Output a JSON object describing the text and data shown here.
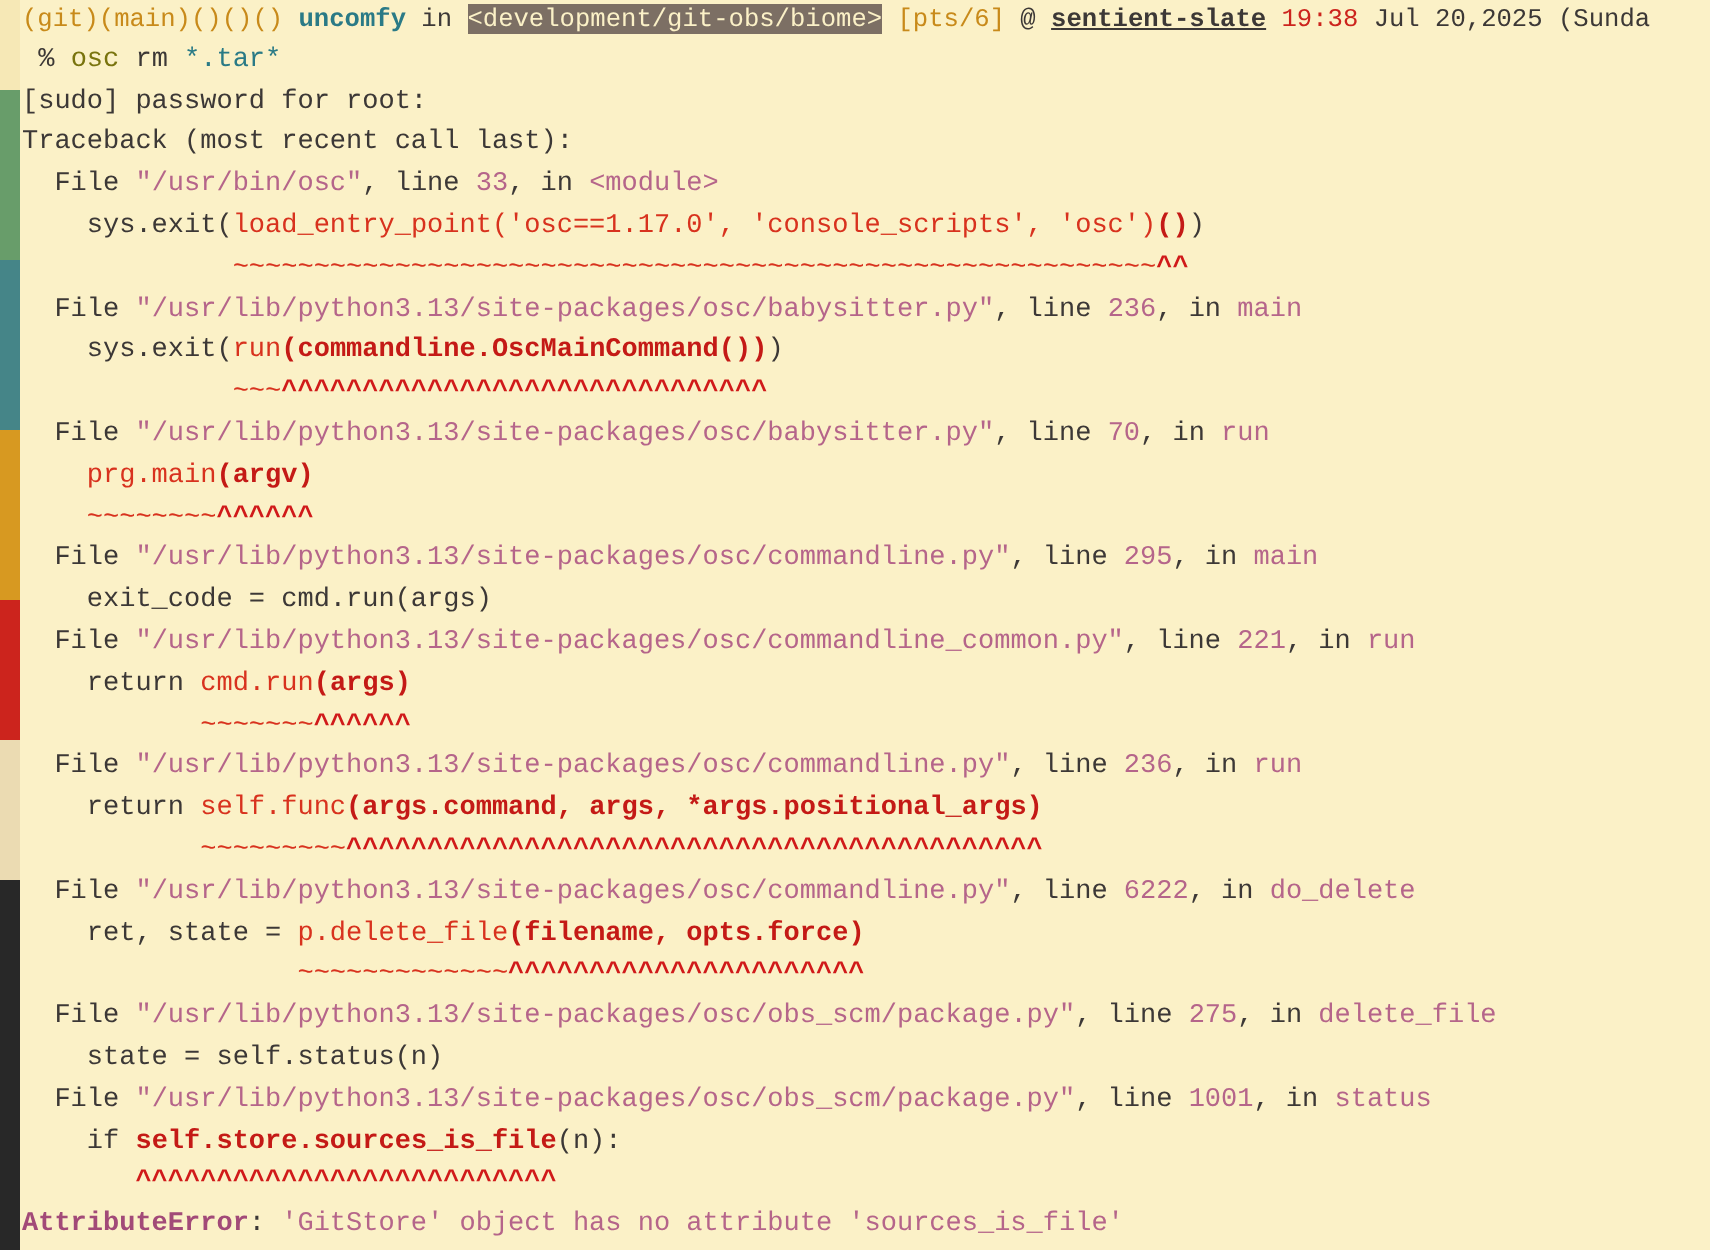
{
  "prompt": [
    {
      "kind": "git",
      "text": "(git)(main)()()()"
    },
    {
      "kind": "user",
      "text": " uncomfy"
    },
    {
      "kind": "plain",
      "text": " in "
    },
    {
      "kind": "dir",
      "text": "<development/git-obs/biome>"
    },
    {
      "kind": "git",
      "text": " [pts/6]"
    },
    {
      "kind": "plain",
      "text": " @ "
    },
    {
      "kind": "host",
      "text": "sentient-slate"
    },
    {
      "kind": "time",
      "text": " 19:38"
    },
    {
      "kind": "plain",
      "text": " Jul 20,2025 (Sunda"
    }
  ],
  "command": [
    {
      "kind": "plain",
      "text": " % "
    },
    {
      "kind": "cmd",
      "text": "osc"
    },
    {
      "kind": "plain",
      "text": " rm "
    },
    {
      "kind": "arg",
      "text": "*.tar*"
    }
  ],
  "lines": [
    [
      {
        "kind": "plain",
        "text": "[sudo] password for root:"
      }
    ],
    [
      {
        "kind": "plain",
        "text": "Traceback (most recent call last):"
      }
    ],
    [
      {
        "kind": "plain",
        "text": "  File "
      },
      {
        "kind": "pink",
        "text": "\"/usr/bin/osc\""
      },
      {
        "kind": "plain",
        "text": ", line "
      },
      {
        "kind": "pink",
        "text": "33"
      },
      {
        "kind": "plain",
        "text": ", in "
      },
      {
        "kind": "pink",
        "text": "<module>"
      }
    ],
    [
      {
        "kind": "plain",
        "text": "    sys.exit("
      },
      {
        "kind": "call",
        "text": "load_entry_point('osc==1.17.0', 'console_scripts', 'osc')"
      },
      {
        "kind": "bold",
        "text": "()"
      },
      {
        "kind": "plain",
        "text": ")"
      }
    ],
    [
      {
        "kind": "tilde",
        "text": "             ~~~~~~~~~~~~~~~~~~~~~~~~~~~~~~~~~~~~~~~~~~~~~~~~~~~~~~~~~"
      },
      {
        "kind": "caret",
        "text": "^^"
      }
    ],
    [
      {
        "kind": "plain",
        "text": "  File "
      },
      {
        "kind": "pink",
        "text": "\"/usr/lib/python3.13/site-packages/osc/babysitter.py\""
      },
      {
        "kind": "plain",
        "text": ", line "
      },
      {
        "kind": "pink",
        "text": "236"
      },
      {
        "kind": "plain",
        "text": ", in "
      },
      {
        "kind": "pink",
        "text": "main"
      }
    ],
    [
      {
        "kind": "plain",
        "text": "    sys.exit("
      },
      {
        "kind": "call",
        "text": "run"
      },
      {
        "kind": "bold",
        "text": "(commandline.OscMainCommand())"
      },
      {
        "kind": "plain",
        "text": ")"
      }
    ],
    [
      {
        "kind": "tilde",
        "text": "             ~~~"
      },
      {
        "kind": "caret",
        "text": "^^^^^^^^^^^^^^^^^^^^^^^^^^^^^^"
      }
    ],
    [
      {
        "kind": "plain",
        "text": "  File "
      },
      {
        "kind": "pink",
        "text": "\"/usr/lib/python3.13/site-packages/osc/babysitter.py\""
      },
      {
        "kind": "plain",
        "text": ", line "
      },
      {
        "kind": "pink",
        "text": "70"
      },
      {
        "kind": "plain",
        "text": ", in "
      },
      {
        "kind": "pink",
        "text": "run"
      }
    ],
    [
      {
        "kind": "call",
        "text": "    prg.main"
      },
      {
        "kind": "bold",
        "text": "(argv)"
      }
    ],
    [
      {
        "kind": "tilde",
        "text": "    ~~~~~~~~"
      },
      {
        "kind": "caret",
        "text": "^^^^^^"
      }
    ],
    [
      {
        "kind": "plain",
        "text": "  File "
      },
      {
        "kind": "pink",
        "text": "\"/usr/lib/python3.13/site-packages/osc/commandline.py\""
      },
      {
        "kind": "plain",
        "text": ", line "
      },
      {
        "kind": "pink",
        "text": "295"
      },
      {
        "kind": "plain",
        "text": ", in "
      },
      {
        "kind": "pink",
        "text": "main"
      }
    ],
    [
      {
        "kind": "plain",
        "text": "    exit_code = cmd.run(args)"
      }
    ],
    [
      {
        "kind": "plain",
        "text": "  File "
      },
      {
        "kind": "pink",
        "text": "\"/usr/lib/python3.13/site-packages/osc/commandline_common.py\""
      },
      {
        "kind": "plain",
        "text": ", line "
      },
      {
        "kind": "pink",
        "text": "221"
      },
      {
        "kind": "plain",
        "text": ", in "
      },
      {
        "kind": "pink",
        "text": "run"
      }
    ],
    [
      {
        "kind": "plain",
        "text": "    return "
      },
      {
        "kind": "call",
        "text": "cmd.run"
      },
      {
        "kind": "bold",
        "text": "(args)"
      }
    ],
    [
      {
        "kind": "tilde",
        "text": "           ~~~~~~~"
      },
      {
        "kind": "caret",
        "text": "^^^^^^"
      }
    ],
    [
      {
        "kind": "plain",
        "text": "  File "
      },
      {
        "kind": "pink",
        "text": "\"/usr/lib/python3.13/site-packages/osc/commandline.py\""
      },
      {
        "kind": "plain",
        "text": ", line "
      },
      {
        "kind": "pink",
        "text": "236"
      },
      {
        "kind": "plain",
        "text": ", in "
      },
      {
        "kind": "pink",
        "text": "run"
      }
    ],
    [
      {
        "kind": "plain",
        "text": "    return "
      },
      {
        "kind": "call",
        "text": "self.func"
      },
      {
        "kind": "bold",
        "text": "(args.command, args, *args.positional_args)"
      }
    ],
    [
      {
        "kind": "tilde",
        "text": "           ~~~~~~~~~"
      },
      {
        "kind": "caret",
        "text": "^^^^^^^^^^^^^^^^^^^^^^^^^^^^^^^^^^^^^^^^^^^"
      }
    ],
    [
      {
        "kind": "plain",
        "text": "  File "
      },
      {
        "kind": "pink",
        "text": "\"/usr/lib/python3.13/site-packages/osc/commandline.py\""
      },
      {
        "kind": "plain",
        "text": ", line "
      },
      {
        "kind": "pink",
        "text": "6222"
      },
      {
        "kind": "plain",
        "text": ", in "
      },
      {
        "kind": "pink",
        "text": "do_delete"
      }
    ],
    [
      {
        "kind": "plain",
        "text": "    ret, state = "
      },
      {
        "kind": "call",
        "text": "p.delete_file"
      },
      {
        "kind": "bold",
        "text": "(filename, opts.force)"
      }
    ],
    [
      {
        "kind": "tilde",
        "text": "                 ~~~~~~~~~~~~~"
      },
      {
        "kind": "caret",
        "text": "^^^^^^^^^^^^^^^^^^^^^^"
      }
    ],
    [
      {
        "kind": "plain",
        "text": "  File "
      },
      {
        "kind": "pink",
        "text": "\"/usr/lib/python3.13/site-packages/osc/obs_scm/package.py\""
      },
      {
        "kind": "plain",
        "text": ", line "
      },
      {
        "kind": "pink",
        "text": "275"
      },
      {
        "kind": "plain",
        "text": ", in "
      },
      {
        "kind": "pink",
        "text": "delete_file"
      }
    ],
    [
      {
        "kind": "plain",
        "text": "    state = self.status(n)"
      }
    ],
    [
      {
        "kind": "plain",
        "text": "  File "
      },
      {
        "kind": "pink",
        "text": "\"/usr/lib/python3.13/site-packages/osc/obs_scm/package.py\""
      },
      {
        "kind": "plain",
        "text": ", line "
      },
      {
        "kind": "pink",
        "text": "1001"
      },
      {
        "kind": "plain",
        "text": ", in "
      },
      {
        "kind": "pink",
        "text": "status"
      }
    ],
    [
      {
        "kind": "plain",
        "text": "    if "
      },
      {
        "kind": "bold",
        "text": "self.store.sources_is_file"
      },
      {
        "kind": "plain",
        "text": "(n):"
      }
    ],
    [
      {
        "kind": "caret",
        "text": "       ^^^^^^^^^^^^^^^^^^^^^^^^^^"
      }
    ],
    [
      {
        "kind": "errname",
        "text": "AttributeError"
      },
      {
        "kind": "plain",
        "text": ": "
      },
      {
        "kind": "pink",
        "text": "'GitStore' object has no attribute 'sources_is_file'"
      }
    ]
  ]
}
